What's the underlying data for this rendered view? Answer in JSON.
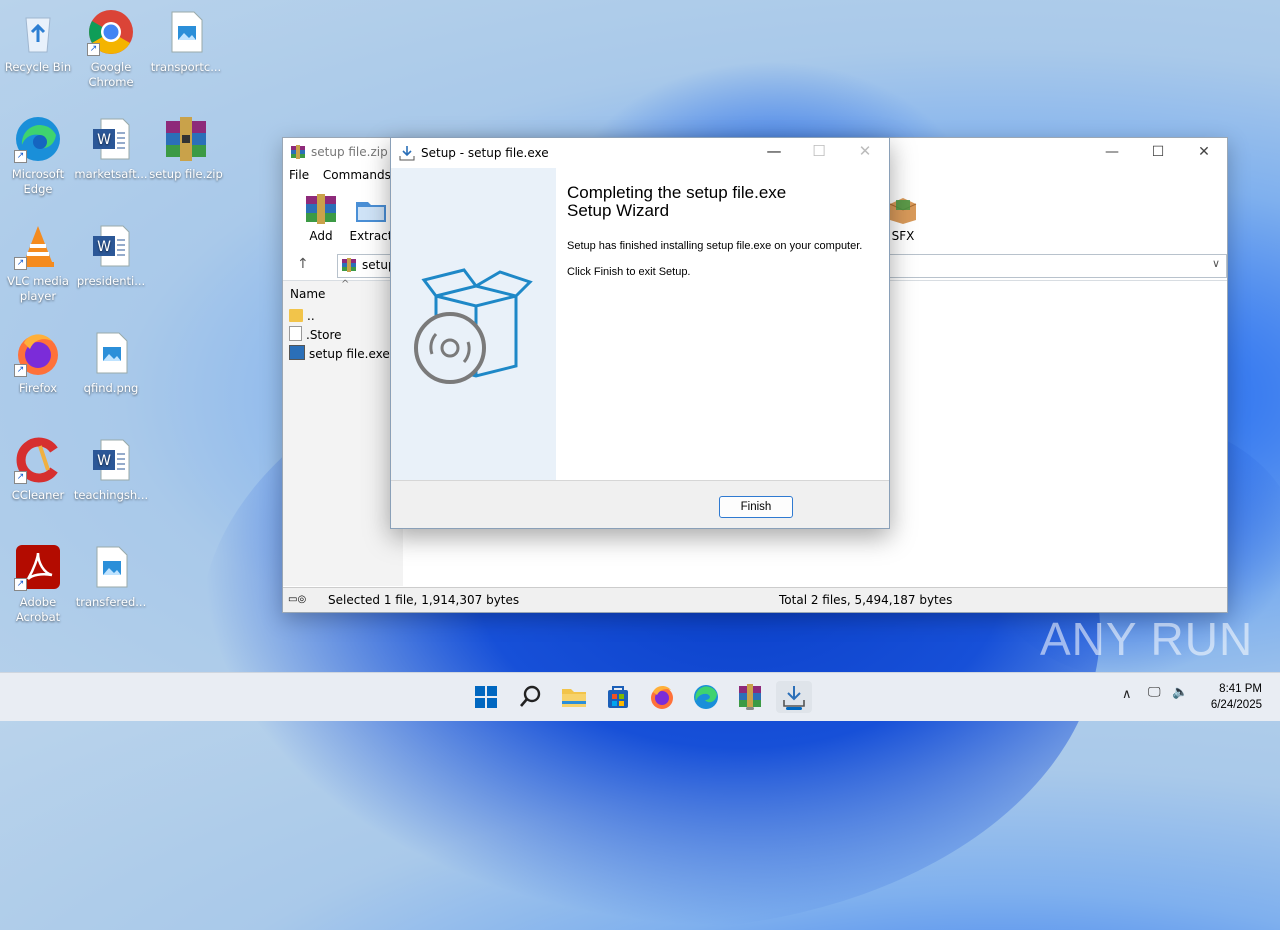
{
  "desktop": {
    "icons": [
      {
        "label": "Recycle Bin"
      },
      {
        "label": "Google Chrome"
      },
      {
        "label": "transportc..."
      },
      {
        "label": "Microsoft Edge"
      },
      {
        "label": "marketsaft..."
      },
      {
        "label": "setup file.zip"
      },
      {
        "label": "VLC media player"
      },
      {
        "label": "presidenti..."
      },
      {
        "label": "Firefox"
      },
      {
        "label": "qfind.png"
      },
      {
        "label": "CCleaner"
      },
      {
        "label": "teachingsh..."
      },
      {
        "label": "Adobe Acrobat"
      },
      {
        "label": "transfered..."
      }
    ]
  },
  "winrar": {
    "title": "setup file.zip",
    "menu": [
      "File",
      "Commands"
    ],
    "toolbar": {
      "add": "Add",
      "extract": "Extract",
      "sfx": "SFX"
    },
    "address": "setup",
    "column_name": "Name",
    "files": [
      {
        "name": ".."
      },
      {
        "name": ".Store"
      },
      {
        "name": "setup file.exe"
      }
    ],
    "status_left": "Selected 1 file, 1,914,307 bytes",
    "status_right": "Total 2 files, 5,494,187 bytes"
  },
  "setup_dialog": {
    "title": "Setup - setup file.exe",
    "heading_line1": "Completing the setup file.exe",
    "heading_line2": "Setup Wizard",
    "text1": "Setup has finished installing setup file.exe on your computer.",
    "text2": "Click Finish to exit Setup.",
    "finish_label": "Finish"
  },
  "watermark": "ANY RUN",
  "taskbar": {
    "time": "8:41 PM",
    "date": "6/24/2025",
    "accent": "#0067c0"
  }
}
